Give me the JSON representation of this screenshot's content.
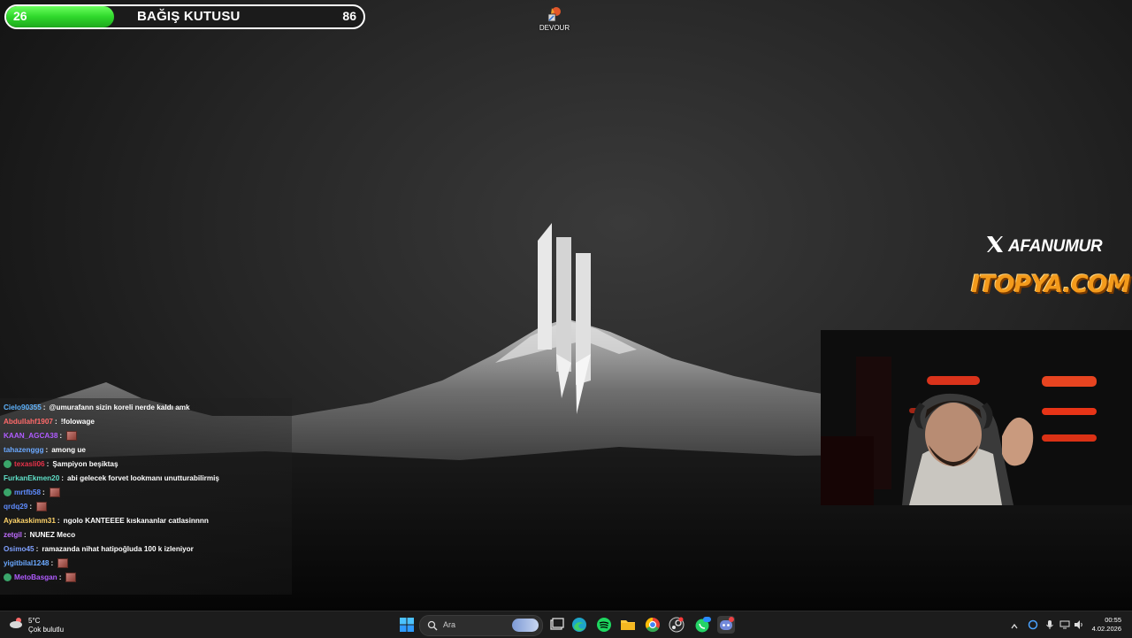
{
  "donation": {
    "title": "BAĞIŞ KUTUSU",
    "current": "26",
    "goal": "86",
    "progress_fraction": 0.302,
    "fill_color": "#2fd82b"
  },
  "desktop": {
    "icons": [
      {
        "label": "DEVOUR",
        "icon": "devour-game-icon"
      }
    ]
  },
  "overlay": {
    "x_handle": "AFANUMUR",
    "sponsor": "ITOPYA.COM"
  },
  "chat": {
    "messages": [
      {
        "user": "Cielo90355",
        "color": "#5fb4ff",
        "text": "@umurafann sizin koreli nerde kaldı amk",
        "badge": false,
        "emote": false
      },
      {
        "user": "Abdullahf1907",
        "color": "#ff6a6a",
        "text": "!folowage",
        "badge": false,
        "emote": false
      },
      {
        "user": "KAAN_AGCA38",
        "color": "#b05cff",
        "text": "",
        "badge": false,
        "emote": true
      },
      {
        "user": "tahazenggg",
        "color": "#6aa8ff",
        "text": "among ue",
        "badge": false,
        "emote": false
      },
      {
        "user": "texasli06",
        "color": "#e8324a",
        "text": "Şampiyon beşiktaş",
        "badge": true,
        "emote": false
      },
      {
        "user": "FurkanEkmen20",
        "color": "#5fe0c8",
        "text": "abi gelecek forvet lookmanı unutturabilirmiş",
        "badge": false,
        "emote": false
      },
      {
        "user": "mrtfb58",
        "color": "#5f8cff",
        "text": "",
        "badge": true,
        "emote": true
      },
      {
        "user": "qrdq29",
        "color": "#5f8cff",
        "text": "",
        "badge": false,
        "emote": true
      },
      {
        "user": "Ayakaskimm31",
        "color": "#ffd46a",
        "text": "ngolo KANTEEEE kıskananlar catlasinnnn",
        "badge": false,
        "emote": false
      },
      {
        "user": "zetgil",
        "color": "#c06cff",
        "text": "NUNEZ Meco",
        "badge": false,
        "emote": false
      },
      {
        "user": "Osimo45",
        "color": "#7fa0ff",
        "text": "ramazanda nihat hatipoğluda 100 k izleniyor",
        "badge": false,
        "emote": false
      },
      {
        "user": "yigitbilal1248",
        "color": "#6aa8ff",
        "text": "",
        "badge": false,
        "emote": true
      },
      {
        "user": "MetoBasgan",
        "color": "#b05cff",
        "text": "",
        "badge": true,
        "emote": true
      }
    ]
  },
  "taskbar": {
    "weather_temp": "5°C",
    "weather_condition": "Çok bulutlu",
    "search_placeholder": "Ara",
    "clock_time": "00:55",
    "clock_date": "4.02.2026",
    "pinned": [
      "windows-start-icon",
      "search-icon",
      "task-view-icon",
      "edge-icon",
      "spotify-icon",
      "file-explorer-icon",
      "chrome-icon",
      "steam-icon",
      "whatsapp-icon",
      "discord-icon"
    ]
  }
}
